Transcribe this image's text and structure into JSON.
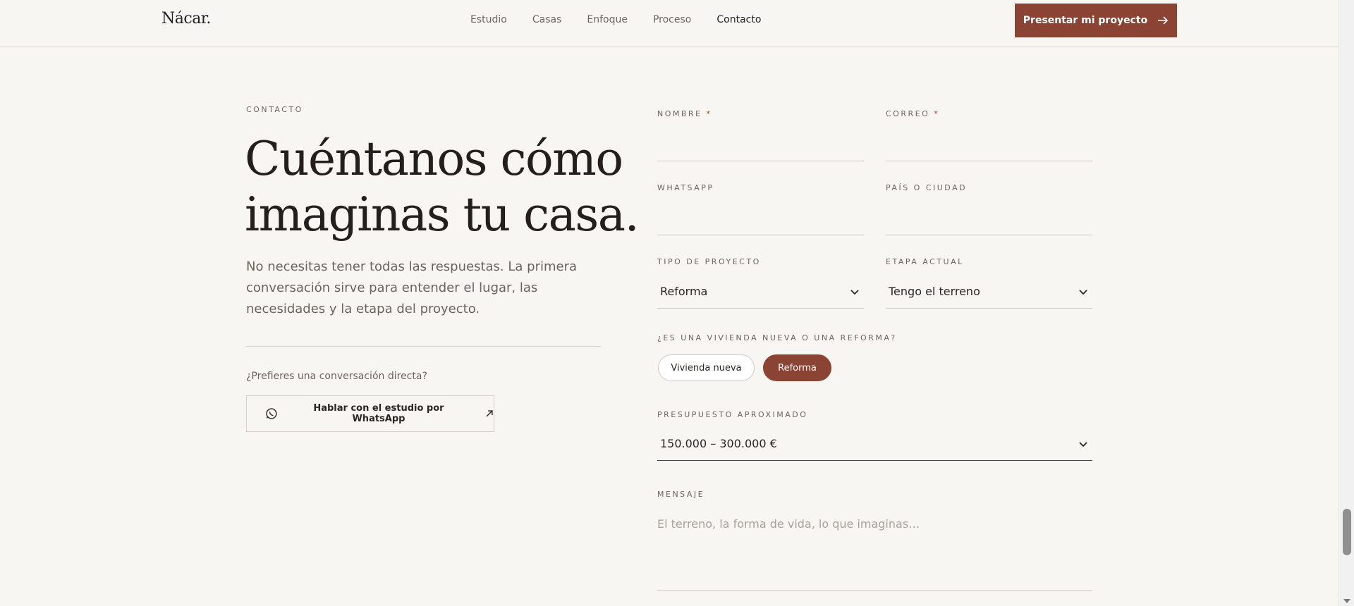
{
  "header": {
    "logo": "Nácar.",
    "nav": [
      "Estudio",
      "Casas",
      "Enfoque",
      "Proceso",
      "Contacto"
    ],
    "active_nav": "Contacto",
    "cta_label": "Presentar mi proyecto"
  },
  "intro": {
    "eyebrow": "CONTACTO",
    "title_line1": "Cuéntanos cómo",
    "title_line2": "imaginas tu casa.",
    "lead": "No necesitas tener todas las respuestas. La primera conversación sirve para entender el lugar, las necesidades y la etapa del proyecto.",
    "direct_question": "¿Prefieres una conversación directa?",
    "whatsapp_label": "Hablar con el estudio por WhatsApp"
  },
  "form": {
    "nombre_label": "NOMBRE",
    "correo_label": "CORREO",
    "required_mark": "*",
    "whatsapp_label": "WHATSAPP",
    "pais_label": "PAÍS O CIUDAD",
    "tipo_label": "TIPO DE PROYECTO",
    "tipo_value": "Reforma",
    "etapa_label": "ETAPA ACTUAL",
    "etapa_value": "Tengo el terreno",
    "vivienda_label": "¿ES UNA VIVIENDA NUEVA O UNA REFORMA?",
    "vivienda_options": [
      "Vivienda nueva",
      "Reforma"
    ],
    "vivienda_selected": "Reforma",
    "presupuesto_label": "PRESUPUESTO APROXIMADO",
    "presupuesto_value": "150.000 – 300.000 €",
    "mensaje_label": "MENSAJE",
    "mensaje_placeholder": "El terreno, la forma de vida, lo que imaginas…"
  },
  "colors": {
    "accent": "#8b4434",
    "background": "#f8f6f2",
    "text": "#2a2622",
    "muted": "#6a645e"
  },
  "icons": {
    "cta_arrow": "arrow-right-icon",
    "whatsapp": "whatsapp-icon",
    "external": "arrow-up-right-icon",
    "select": "chevron-down-icon"
  }
}
